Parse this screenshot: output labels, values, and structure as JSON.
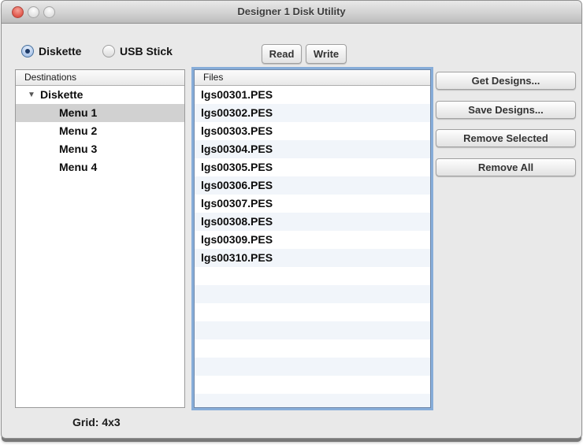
{
  "window": {
    "title": "Designer 1 Disk Utility",
    "status_grid": "Grid: 4x3"
  },
  "icons": {
    "disclosure_triangle": "▼"
  },
  "mode": {
    "options": [
      {
        "label": "Diskette",
        "selected": true
      },
      {
        "label": "USB Stick",
        "selected": false
      }
    ]
  },
  "toolbar": {
    "read_label": "Read",
    "write_label": "Write"
  },
  "destinations": {
    "header": "Destinations",
    "root": {
      "label": "Diskette",
      "expanded": true
    },
    "items": [
      {
        "label": "Menu 1",
        "selected": true
      },
      {
        "label": "Menu 2",
        "selected": false
      },
      {
        "label": "Menu 3",
        "selected": false
      },
      {
        "label": "Menu 4",
        "selected": false
      }
    ]
  },
  "files": {
    "header": "Files",
    "items": [
      "lgs00301.PES",
      "lgs00302.PES",
      "lgs00303.PES",
      "lgs00304.PES",
      "lgs00305.PES",
      "lgs00306.PES",
      "lgs00307.PES",
      "lgs00308.PES",
      "lgs00309.PES",
      "lgs00310.PES"
    ]
  },
  "actions": {
    "get_designs": "Get Designs...",
    "save_designs": "Save Designs...",
    "remove_selected": "Remove Selected",
    "remove_all": "Remove All"
  },
  "colors": {
    "focus_ring": "#87add9",
    "selection_gray": "#d1d1d1",
    "alt_row": "#f1f5fa",
    "close_button": "#e0564a"
  }
}
